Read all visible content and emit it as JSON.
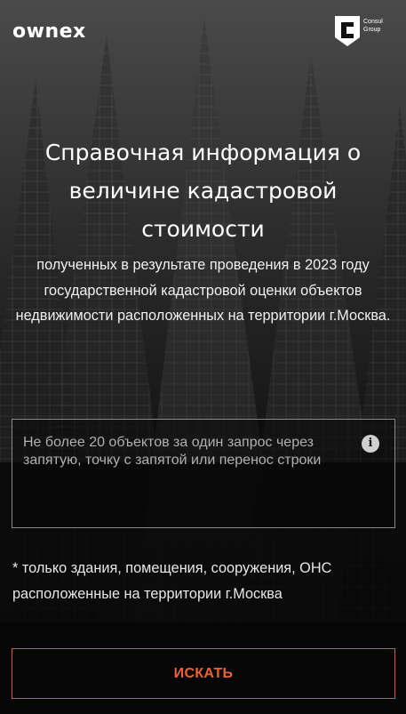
{
  "header": {
    "brand_logo": "ownex",
    "partner_logo_text": [
      "Consul",
      "Group"
    ]
  },
  "hero": {
    "title": "Справочная информация о величине кадастровой стоимости",
    "subtitle": "полученных в результате проведения в 2023 году государственной кадастровой оценки объектов недвижимости расположенных на территории г.Москва."
  },
  "query": {
    "placeholder": "Не более 20 объектов за один запрос через запятую, точку с запятой или перенос строки",
    "value": "",
    "info_icon": "info-circle-icon"
  },
  "note": "* только здания, помещения, сооружения, ОНС расположенные на территории г.Москва",
  "search_button": {
    "label": "ИСКАТЬ",
    "color": "#f0612f"
  },
  "colors": {
    "background": "#0b0b0b",
    "accent": "#e0552b"
  }
}
